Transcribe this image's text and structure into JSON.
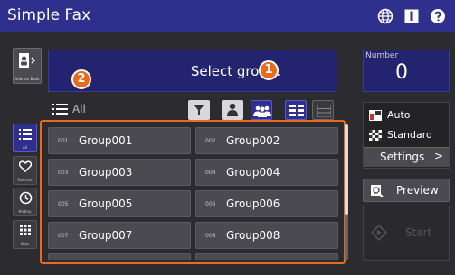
{
  "app": {
    "title": "Simple Fax"
  },
  "header_icons": [
    "globe-icon",
    "info-icon",
    "help-icon"
  ],
  "address_book": {
    "label": "Address Book"
  },
  "banner": {
    "text": "Select group."
  },
  "badges": {
    "one": "1",
    "two": "2"
  },
  "list_header": {
    "label": "All"
  },
  "side_tabs": [
    {
      "label": "All",
      "icon": "list-icon"
    },
    {
      "label": "Favorite",
      "icon": "heart-icon"
    },
    {
      "label": "History",
      "icon": "history-icon"
    },
    {
      "label": "Keys",
      "icon": "keypad-icon"
    }
  ],
  "groups": [
    {
      "num": "001",
      "name": "Group001"
    },
    {
      "num": "002",
      "name": "Group002"
    },
    {
      "num": "003",
      "name": "Group003"
    },
    {
      "num": "004",
      "name": "Group004"
    },
    {
      "num": "005",
      "name": "Group005"
    },
    {
      "num": "006",
      "name": "Group006"
    },
    {
      "num": "007",
      "name": "Group007"
    },
    {
      "num": "008",
      "name": "Group008"
    }
  ],
  "number": {
    "label": "Number",
    "value": "0"
  },
  "options": {
    "resolution": "Auto",
    "mode": "Standard",
    "settings_label": "Settings",
    "settings_chevron": ">"
  },
  "preview": {
    "label": "Preview"
  },
  "start": {
    "label": "Start"
  },
  "colors": {
    "accent": "#2f2f8e",
    "badge": "#e86a1c"
  }
}
